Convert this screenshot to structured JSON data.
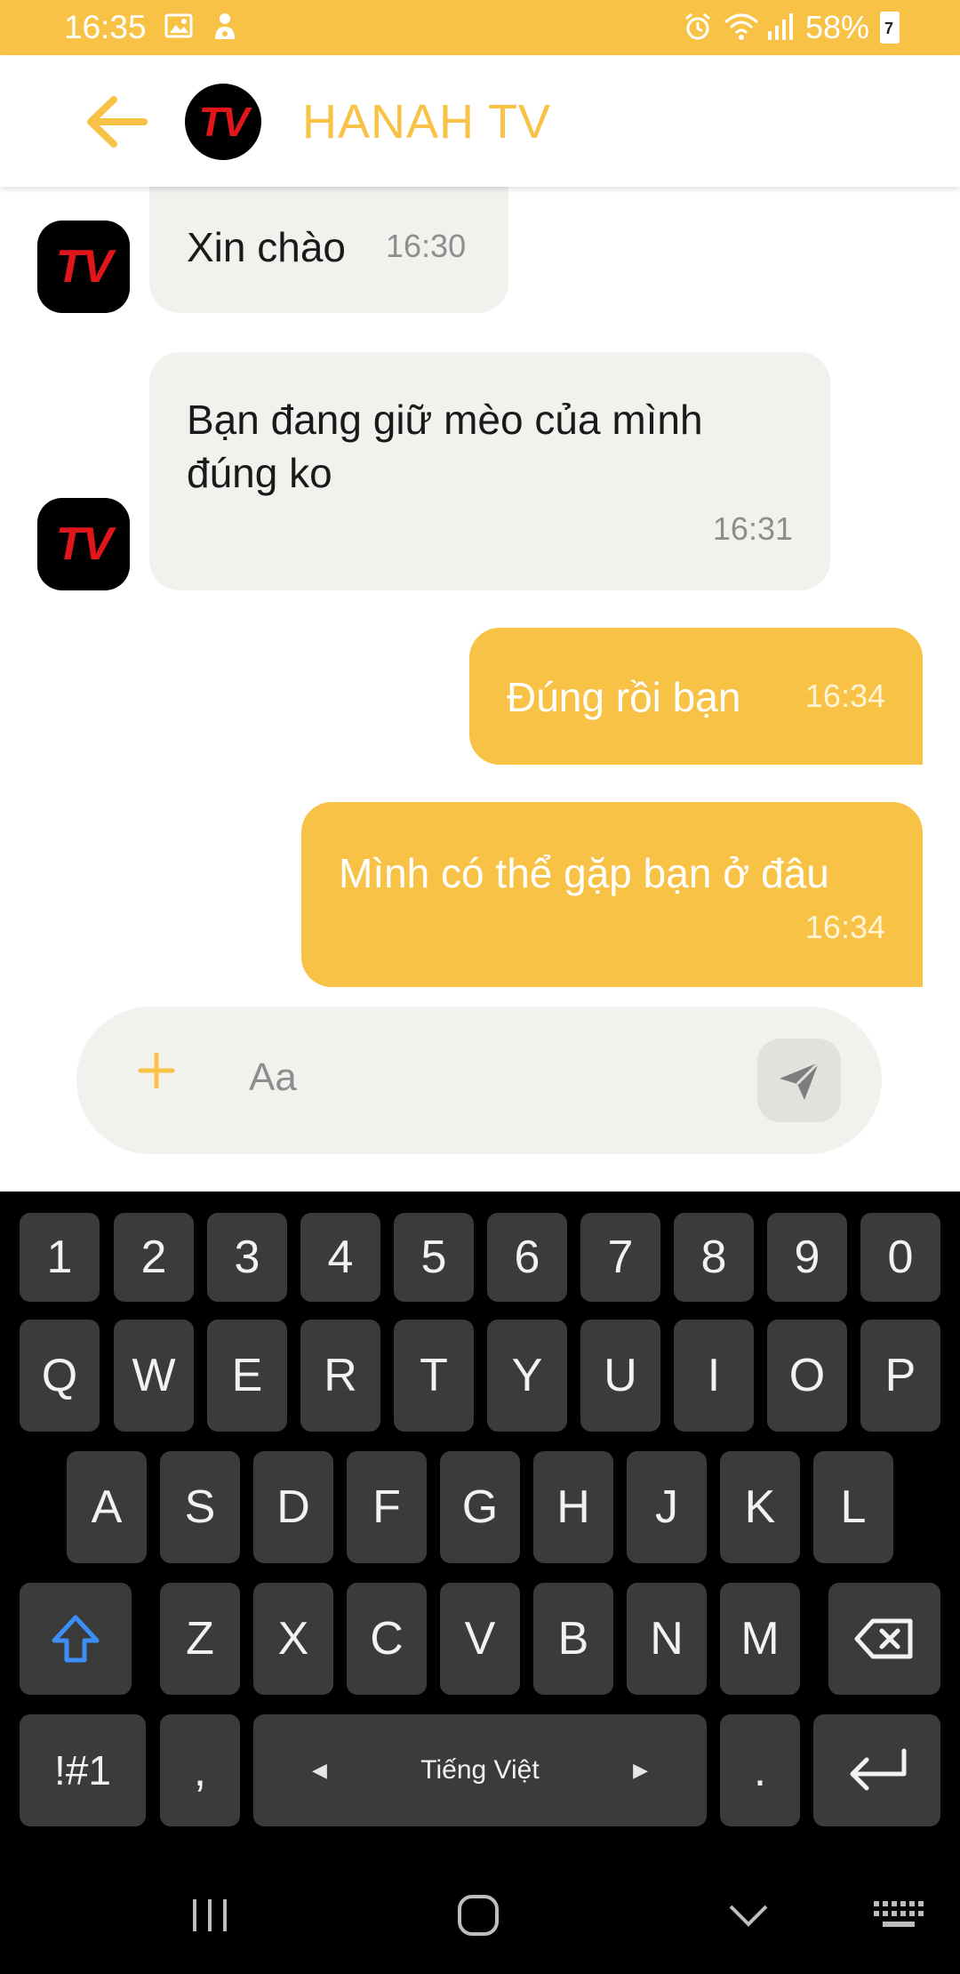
{
  "status_bar": {
    "time": "16:35",
    "battery_percent": "58%",
    "battery_level_glyph": "7",
    "left_icons": [
      "gallery-icon",
      "notification-icon"
    ],
    "right_icons": [
      "alarm-icon",
      "wifi-icon",
      "signal-icon",
      "battery-icon"
    ]
  },
  "header": {
    "title": "HANAH TV",
    "avatar_text": "TV",
    "back_icon": "arrow-left-icon"
  },
  "messages": [
    {
      "direction": "incoming",
      "text": "Xin chào",
      "time": "16:30",
      "avatar_text": "TV"
    },
    {
      "direction": "incoming",
      "text_lines": [
        "Bạn đang giữ mèo của mình",
        "đúng ko"
      ],
      "time": "16:31",
      "avatar_text": "TV"
    },
    {
      "direction": "outgoing",
      "text": "Đúng rồi bạn",
      "time": "16:34"
    },
    {
      "direction": "outgoing",
      "text": "Mình có thể gặp bạn ở đâu",
      "time": "16:34"
    }
  ],
  "composer": {
    "placeholder": "Aa",
    "add_icon": "plus-icon",
    "send_icon": "send-icon"
  },
  "keyboard": {
    "row_numbers": [
      "1",
      "2",
      "3",
      "4",
      "5",
      "6",
      "7",
      "8",
      "9",
      "0"
    ],
    "row_top": [
      "Q",
      "W",
      "E",
      "R",
      "T",
      "Y",
      "U",
      "I",
      "O",
      "P"
    ],
    "row_middle": [
      "A",
      "S",
      "D",
      "F",
      "G",
      "H",
      "J",
      "K",
      "L"
    ],
    "row_bottom": [
      "Z",
      "X",
      "C",
      "V",
      "B",
      "N",
      "M"
    ],
    "symbols_label": "!#1",
    "comma_label": ",",
    "space_label": "Tiếng Việt",
    "period_label": ".",
    "shift_icon": "shift-icon",
    "backspace_icon": "backspace-icon",
    "enter_icon": "enter-icon"
  },
  "colors": {
    "accent": "#f8c246",
    "incoming_bubble": "#f2f1ee",
    "keyboard_bg": "#000000",
    "key_bg": "#3b3b3b",
    "shift_blue": "#3e8ef7"
  }
}
